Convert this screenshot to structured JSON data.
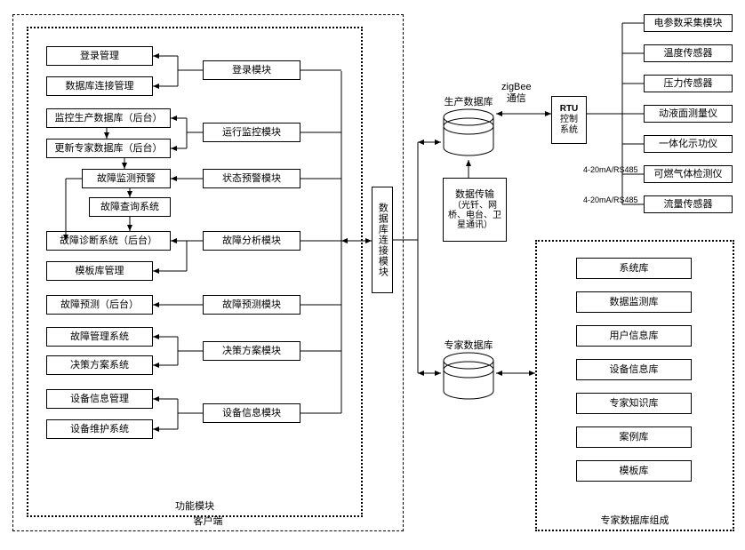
{
  "client": {
    "caption": "客户端",
    "func_caption": "功能模块",
    "left": {
      "login_mgmt": "登录管理",
      "db_conn_mgmt": "数据库连接管理",
      "monitor_prod_db": "监控生产数据库（后台）",
      "update_expert_db": "更新专家数据库（后台）",
      "fault_monitor_warn": "故障监测预警",
      "fault_query_sys": "故障查询系统",
      "fault_diag_sys": "故障诊断系统（后台）",
      "template_mgmt": "模板库管理",
      "fault_forecast": "故障预测（后台）",
      "fault_mgmt_sys": "故障管理系统",
      "decision_sys": "决策方案系统",
      "equip_info_mgmt": "设备信息管理",
      "equip_maint_sys": "设备维护系统"
    },
    "right": {
      "login_mod": "登录模块",
      "run_monitor_mod": "运行监控模块",
      "state_warn_mod": "状态预警模块",
      "fault_analysis_mod": "故障分析模块",
      "fault_forecast_mod": "故障预测模块",
      "decision_mod": "决策方案模块",
      "equip_info_mod": "设备信息模块"
    }
  },
  "center": {
    "db_conn_module": "数据库连接模块",
    "prod_db": "生产数据库",
    "expert_db": "专家数据库",
    "data_transfer_title": "数据传输",
    "data_transfer_sub": "（光钎、网桥、电台、卫星通讯）"
  },
  "comm": {
    "zigbee": "zigBee\n通信",
    "rtu_line1": "RTU",
    "rtu_line2": "控制",
    "rtu_line3": "系统",
    "sig1": "4-20mA/RS485",
    "sig2": "4-20mA/RS485"
  },
  "sensors": {
    "elec": "电参数采集模块",
    "temp": "温度传感器",
    "pressure": "压力传感器",
    "liquid": "动液面测量仪",
    "dynamo": "一体化示功仪",
    "gas": "可燃气体检测仪",
    "flow": "流量传感器"
  },
  "expert_panel": {
    "caption": "专家数据库组成",
    "sys_lib": "系统库",
    "data_monitor_lib": "数据监测库",
    "user_info_lib": "用户信息库",
    "equip_info_lib": "设备信息库",
    "expert_knowledge_lib": "专家知识库",
    "case_lib": "案例库",
    "template_lib": "模板库"
  }
}
